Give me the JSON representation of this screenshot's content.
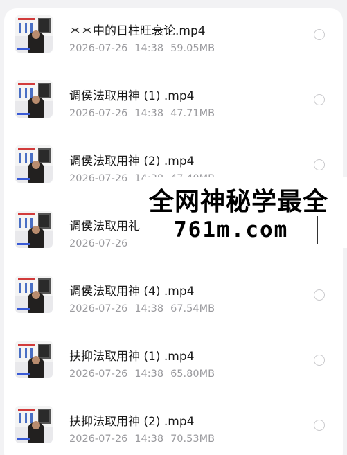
{
  "files": [
    {
      "name": "＊＊中的日柱旺衰论.mp4",
      "date": "2026-07-26",
      "time": "14:38",
      "size": "59.05MB"
    },
    {
      "name": "调侯法取用神 (1) .mp4",
      "date": "2026-07-26",
      "time": "14:38",
      "size": "47.71MB"
    },
    {
      "name": "调侯法取用神 (2) .mp4",
      "date": "2026-07-26",
      "time": "14:38",
      "size": "47.40MB"
    },
    {
      "name": "调侯法取用礼",
      "date": "2026-07-26",
      "time": "",
      "size": ""
    },
    {
      "name": "调侯法取用神 (4) .mp4",
      "date": "2026-07-26",
      "time": "14:38",
      "size": "67.54MB"
    },
    {
      "name": "扶抑法取用神 (1) .mp4",
      "date": "2026-07-26",
      "time": "14:38",
      "size": "65.80MB"
    },
    {
      "name": "扶抑法取用神 (2) .mp4",
      "date": "2026-07-26",
      "time": "14:38",
      "size": "70.53MB"
    }
  ],
  "watermark": {
    "line1": "全网神秘学最全",
    "line2": "761m.com"
  },
  "colors": {
    "title": "#1a1a1a",
    "meta": "#9a9a9e",
    "radio_border": "#c9c9cc",
    "background": "#f2f2f4"
  },
  "icons": {
    "thumbnail": "video-thumbnail",
    "selector": "radio-circle-icon"
  }
}
